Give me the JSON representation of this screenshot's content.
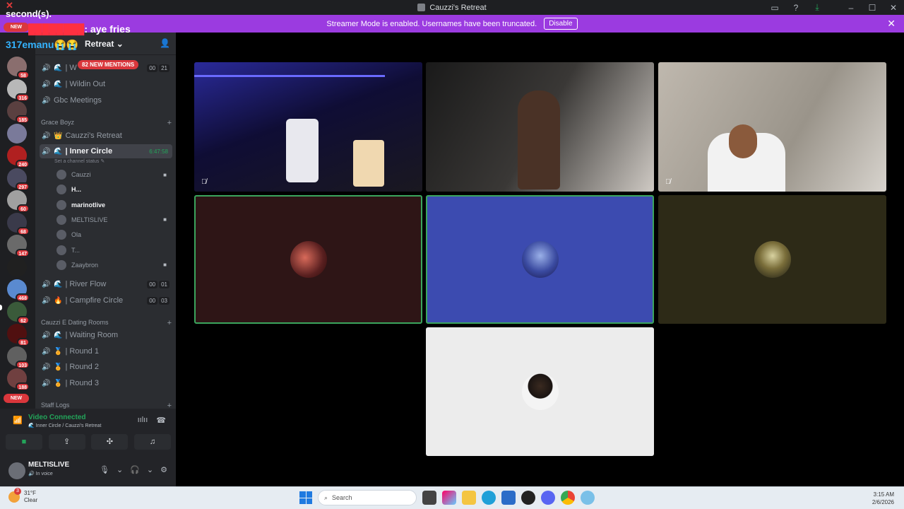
{
  "window": {
    "title": "Cauzzi's Retreat"
  },
  "banner": {
    "text": "Streamer Mode is enabled. Usernames have been truncated.",
    "disable_label": "Disable"
  },
  "overlay": {
    "line1_prefix": "",
    "line2": "second(s).",
    "chat1_text": ": aye fries",
    "chat2_user": "317emanu",
    "chat2_emoji": "😭😭"
  },
  "rail": {
    "new_label": "NEW",
    "badges": [
      "58",
      "316",
      "185",
      "",
      "240",
      "297",
      "60",
      "68",
      "147",
      "",
      "468",
      "62",
      "81",
      "103",
      "188"
    ],
    "bottom_new_label": "NEW"
  },
  "server": {
    "name": "Retreat",
    "mentions": "82 NEW MENTIONS"
  },
  "channels": {
    "top": [
      {
        "label": "| W",
        "counts": [
          "00",
          "21"
        ]
      },
      {
        "label": "| Wildin Out",
        "counts": []
      },
      {
        "label": "Gbc Meetings",
        "counts": []
      }
    ],
    "cat_grace": "Grace Boyz",
    "grace": [
      {
        "label": "Cauzzi's Retreat"
      },
      {
        "label": "| Inner Circle",
        "timer": "6:47:58"
      }
    ],
    "status_sub": "Set a channel status",
    "voice_users": [
      {
        "name": "Cauzzi",
        "bold": false
      },
      {
        "name": "H...",
        "bold": true
      },
      {
        "name": "marinotlive",
        "bold": true
      },
      {
        "name": "MELTISLIVE",
        "bold": false
      },
      {
        "name": "Ola",
        "bold": false
      },
      {
        "name": "T...",
        "bold": false
      },
      {
        "name": "Zaaybron",
        "bold": false
      }
    ],
    "after": [
      {
        "label": "| River Flow",
        "counts": [
          "00",
          "01"
        ]
      },
      {
        "label": "| Campfire Circle",
        "counts": [
          "00",
          "03"
        ]
      }
    ],
    "cat_dating": "Cauzzi E Dating Rooms",
    "dating": [
      {
        "label": "| Waiting Room"
      },
      {
        "label": "| Round 1"
      },
      {
        "label": "| Round 2"
      },
      {
        "label": "| Round 3"
      }
    ],
    "cat_staff": "Staff Logs"
  },
  "voice": {
    "status": "Video Connected",
    "channel": "Inner Circle / Cauzzi's Retreat"
  },
  "user": {
    "name": "MELTISLIVE",
    "sub": "In voice"
  },
  "taskbar": {
    "temp": "31°F",
    "condition": "Clear",
    "weather_badge": "3",
    "search_placeholder": "Search",
    "time": "3:15 AM",
    "date": "2/6/2026"
  },
  "colors": {
    "accent_green": "#3ba55d",
    "banner_purple": "#9b3be0",
    "mention_red": "#da373c",
    "tile_maroon": "#2e1516",
    "tile_blue": "#3c4bb0",
    "tile_olive": "#2d2a17",
    "tile_light": "#ececec"
  }
}
